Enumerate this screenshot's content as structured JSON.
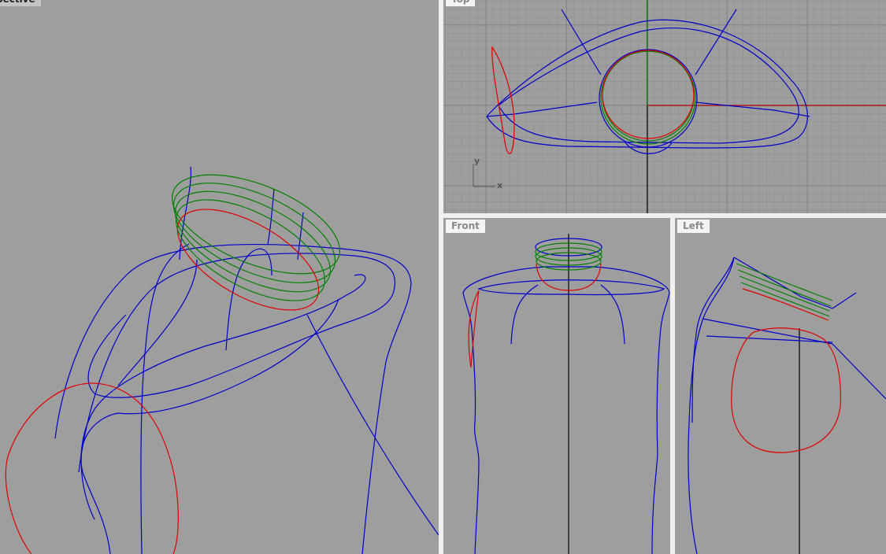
{
  "viewports": {
    "perspective": {
      "label": "Perspective"
    },
    "top": {
      "label": "Top",
      "axis_x": "x",
      "axis_y": "y"
    },
    "front": {
      "label": "Front"
    },
    "left": {
      "label": "Left"
    }
  },
  "colors": {
    "background": "#9e9e9e",
    "curve": "#0000c8",
    "highlight": "#e00000",
    "surface": "#008000"
  }
}
